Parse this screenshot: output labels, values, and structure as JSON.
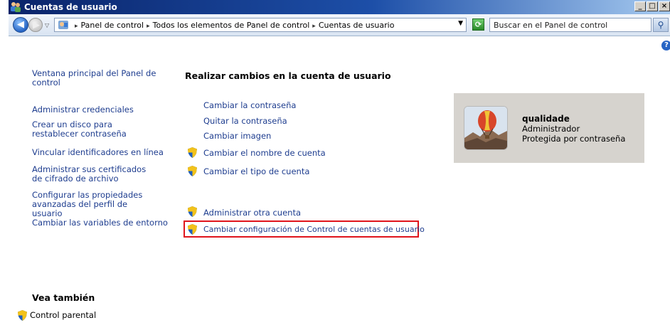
{
  "window": {
    "title": "Cuentas de usuario",
    "min": "_",
    "max": "□",
    "close": "×"
  },
  "nav": {
    "breadcrumb": [
      "Panel de control",
      "Todos los elementos de Panel de control",
      "Cuentas de usuario"
    ],
    "search_placeholder": "Buscar en el Panel de control"
  },
  "left_links": [
    "Ventana principal del Panel de control",
    "Administrar credenciales",
    "Crear un disco para restablecer contraseña",
    "Vincular identificadores en línea",
    "Administrar sus certificados de cifrado de archivo",
    "Configurar las propiedades avanzadas del perfil de usuario",
    "Cambiar las variables de entorno"
  ],
  "main": {
    "heading": "Realizar cambios en la cuenta de usuario",
    "tasks": [
      "Cambiar la contraseña",
      "Quitar la contraseña",
      "Cambiar imagen",
      "Cambiar el nombre de cuenta",
      "Cambiar el tipo de cuenta"
    ],
    "other_tasks": [
      "Administrar otra cuenta",
      "Cambiar configuración de Control de cuentas de usuario"
    ]
  },
  "user": {
    "name": "qualidade",
    "role": "Administrador",
    "status": "Protegida por contraseña"
  },
  "see_also": {
    "heading": "Vea también",
    "links": [
      "Control parental"
    ]
  },
  "colors": {
    "link": "#1e3d8f",
    "highlight": "#e0141b",
    "user_panel": "#d6d3ce"
  }
}
